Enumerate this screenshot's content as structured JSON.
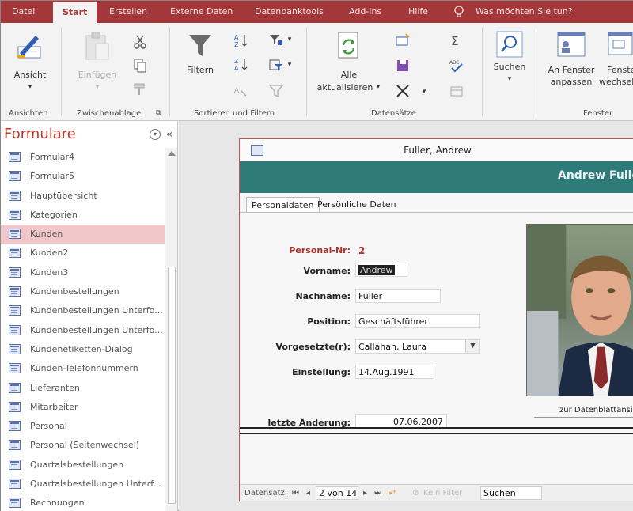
{
  "ribbon_tabs": [
    "Datei",
    "Start",
    "Erstellen",
    "Externe Daten",
    "Datenbanktools",
    "Add-Ins",
    "Hilfe"
  ],
  "tell_me": "Was möchten Sie tun?",
  "ribbon": {
    "ansicht": "Ansicht",
    "einfuegen": "Einfügen",
    "filtern": "Filtern",
    "alle": "Alle",
    "aktualisieren": "aktualisieren",
    "suchen": "Suchen",
    "an_fenster": "An Fenster",
    "anpassen": "anpassen",
    "fenster_short": "Fenste",
    "wechseln_short": "wechsel",
    "groups": {
      "ansichten": "Ansichten",
      "zwischenablage": "Zwischenablage",
      "sortieren": "Sortieren und Filtern",
      "datensaetze": "Datensätze",
      "fenster": "Fenster"
    }
  },
  "nav": {
    "title": "Formulare",
    "items": [
      "Formular4",
      "Formular5",
      "Hauptübersicht",
      "Kategorien",
      "Kunden",
      "Kunden2",
      "Kunden3",
      "Kundenbestellungen",
      "Kundenbestellungen Unterfo...",
      "Kundenbestellungen Unterfo...",
      "Kundenetiketten-Dialog",
      "Kunden-Telefonnummern",
      "Lieferanten",
      "Mitarbeiter",
      "Personal",
      "Personal (Seitenwechsel)",
      "Quartalsbestellungen",
      "Quartalsbestellungen Unterf...",
      "Rechnungen"
    ],
    "selected_index": 4
  },
  "form": {
    "window_title": "Fuller, Andrew",
    "header_name": "Andrew Fuller",
    "tabs": [
      "Personaldaten",
      "Persönliche Daten"
    ],
    "personal_nr_label": "Personal-Nr:",
    "personal_nr": "2",
    "vorname_label": "Vorname:",
    "vorname": "Andrew",
    "nachname_label": "Nachname:",
    "nachname": "Fuller",
    "position_label": "Position:",
    "position": "Geschäftsführer",
    "vorgesetzte_label": "Vorgesetzte(r):",
    "vorgesetzte": "Callahan, Laura",
    "einstellung_label": "Einstellung:",
    "einstellung": "14.Aug.1991",
    "letzte_aenderung_label": "letzte Änderung:",
    "letzte_aenderung": "07.06.2007",
    "datasheet_link": "zur Datenblattansicht"
  },
  "record_nav": {
    "label": "Datensatz:",
    "position": "2 von 14",
    "filter": "Kein Filter",
    "search": "Suchen"
  },
  "colors": {
    "ribbon_tabs_bg": "#a4373a",
    "header_band": "#2f7b7a",
    "nav_title": "#c0392b",
    "selected_item": "#f2c7c9",
    "personal_nr_label": "#b0302c"
  }
}
